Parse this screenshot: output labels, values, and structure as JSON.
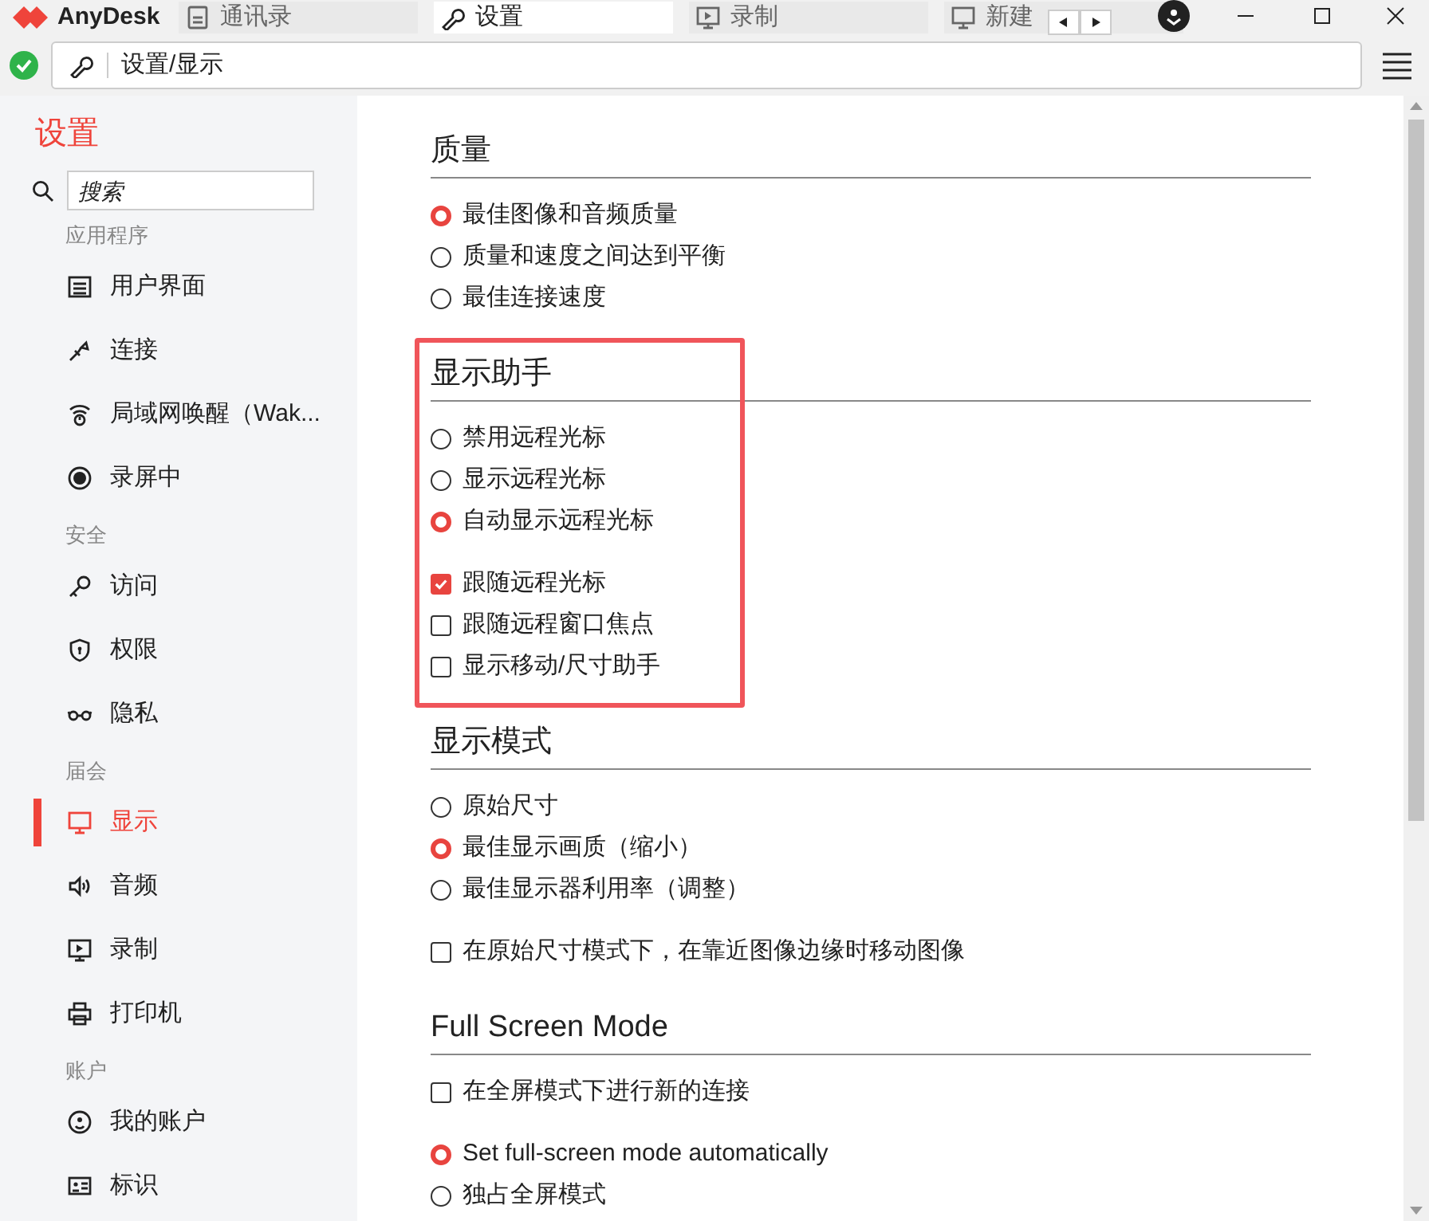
{
  "app": {
    "name": "AnyDesk"
  },
  "tabs": [
    {
      "label": "通讯录",
      "selected": false
    },
    {
      "label": "设置",
      "selected": true
    },
    {
      "label": "录制",
      "selected": false
    },
    {
      "label": "新建",
      "selected": false
    }
  ],
  "address_bar": {
    "value": "设置/显示"
  },
  "sidebar": {
    "title": "设置",
    "search": {
      "placeholder": "搜索"
    },
    "groups": [
      {
        "label": "应用程序",
        "items": [
          {
            "label": "用户界面",
            "selected": false
          },
          {
            "label": "连接",
            "selected": false
          },
          {
            "label": "局域网唤醒（Wak...",
            "selected": false
          },
          {
            "label": "录屏中",
            "selected": false
          }
        ]
      },
      {
        "label": "安全",
        "items": [
          {
            "label": "访问",
            "selected": false
          },
          {
            "label": "权限",
            "selected": false
          },
          {
            "label": "隐私",
            "selected": false
          }
        ]
      },
      {
        "label": "届会",
        "items": [
          {
            "label": "显示",
            "selected": true
          },
          {
            "label": "音频",
            "selected": false
          },
          {
            "label": "录制",
            "selected": false
          },
          {
            "label": "打印机",
            "selected": false
          }
        ]
      },
      {
        "label": "账户",
        "items": [
          {
            "label": "我的账户",
            "selected": false
          },
          {
            "label": "标识",
            "selected": false
          }
        ]
      }
    ]
  },
  "sections": [
    {
      "title": "质量",
      "highlighted": false,
      "groups": [
        [
          {
            "kind": "radio",
            "label": "最佳图像和音频质量",
            "selected": true
          },
          {
            "kind": "radio",
            "label": "质量和速度之间达到平衡",
            "selected": false
          },
          {
            "kind": "radio",
            "label": "最佳连接速度",
            "selected": false
          }
        ]
      ]
    },
    {
      "title": "显示助手",
      "highlighted": true,
      "groups": [
        [
          {
            "kind": "radio",
            "label": "禁用远程光标",
            "selected": false
          },
          {
            "kind": "radio",
            "label": "显示远程光标",
            "selected": false
          },
          {
            "kind": "radio",
            "label": "自动显示远程光标",
            "selected": true
          }
        ],
        [
          {
            "kind": "checkbox",
            "label": "跟随远程光标",
            "checked": true
          },
          {
            "kind": "checkbox",
            "label": "跟随远程窗口焦点",
            "checked": false
          },
          {
            "kind": "checkbox",
            "label": "显示移动/尺寸助手",
            "checked": false
          }
        ]
      ]
    },
    {
      "title": "显示模式",
      "highlighted": false,
      "groups": [
        [
          {
            "kind": "radio",
            "label": "原始尺寸",
            "selected": false
          },
          {
            "kind": "radio",
            "label": "最佳显示画质（缩小）",
            "selected": true
          },
          {
            "kind": "radio",
            "label": "最佳显示器利用率（调整）",
            "selected": false
          }
        ],
        [
          {
            "kind": "checkbox",
            "label": "在原始尺寸模式下，在靠近图像边缘时移动图像",
            "checked": false
          }
        ]
      ]
    },
    {
      "title": "Full Screen Mode",
      "highlighted": false,
      "groups": [
        [
          {
            "kind": "checkbox",
            "label": "在全屏模式下进行新的连接",
            "checked": false
          }
        ],
        [
          {
            "kind": "radio",
            "label": "Set full-screen mode automatically",
            "selected": true
          },
          {
            "kind": "radio",
            "label": "独占全屏模式",
            "selected": false
          }
        ]
      ]
    }
  ]
}
